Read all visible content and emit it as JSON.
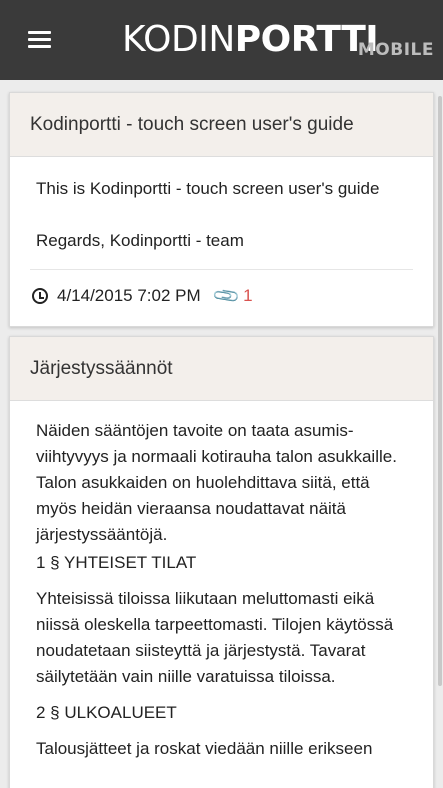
{
  "header": {
    "menu_icon": "hamburger-menu-icon",
    "logo_regular": "KODIN",
    "logo_bold": "PORTTI",
    "logo_sub": "MOBILE",
    "background": "#3a3a3a"
  },
  "posts": [
    {
      "title": "Kodinportti - touch screen user's guide",
      "body": [
        "This is Kodinportti - touch screen user's guide",
        "Regards, Kodinportti - team"
      ],
      "datetime": "4/14/2015 7:02 PM",
      "attachments": "1",
      "clock_icon": "clock-icon",
      "attachment_icon": "paperclip-icon"
    },
    {
      "title": "Järjestyssäännöt",
      "body": [
        "Näiden sääntöjen tavoite on taata asumis-viihtyvyys ja normaali kotirauha talon asukkaille. Talon asukkaiden on huolehdittava siitä, että myös heidän vieraansa noudattavat näitä järjestyssääntöjä.",
        "1 § YHTEISET TILAT",
        "Yhteisissä tiloissa liikutaan meluttomasti eikä niissä oleskella tarpeettomasti. Tilojen käytössä noudatetaan siisteyttä ja järjestystä. Tavarat säilytetään vain niille varatuissa tiloissa.",
        "2 § ULKOALUEET",
        "Talousjätteet ja roskat viedään niille erikseen"
      ]
    }
  ],
  "colors": {
    "card_header": "#f3efeb",
    "attachment": "#d9534f"
  }
}
